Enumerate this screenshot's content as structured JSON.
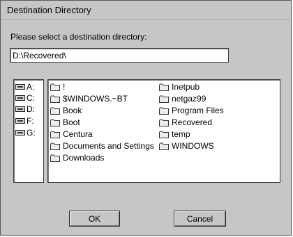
{
  "window": {
    "title": "Destination Directory"
  },
  "prompt": "Please select a destination directory:",
  "path_input": {
    "value": "D:\\Recovered\\"
  },
  "drives": [
    {
      "label": "A:",
      "icon": "drive-icon"
    },
    {
      "label": "C:",
      "icon": "drive-icon"
    },
    {
      "label": "D:",
      "icon": "drive-icon"
    },
    {
      "label": "F:",
      "icon": "drive-icon"
    },
    {
      "label": "G:",
      "icon": "drive-icon"
    }
  ],
  "folders_col1": [
    "!",
    "$WINDOWS.~BT",
    "Book",
    "Boot",
    "Centura",
    "Documents and Settings",
    "Downloads"
  ],
  "folders_col2": [
    "Inetpub",
    "netgaz99",
    "Program Files",
    "Recovered",
    "temp",
    "WINDOWS"
  ],
  "buttons": {
    "ok": "OK",
    "cancel": "Cancel"
  }
}
